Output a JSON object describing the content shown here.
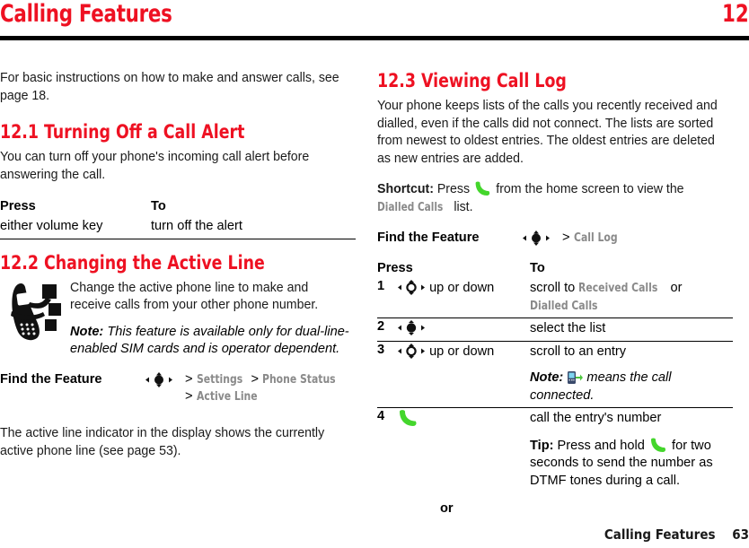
{
  "header": {
    "title": "Calling Features",
    "chapter_number": "12"
  },
  "footer": {
    "title": "Calling Features",
    "page_number": "63"
  },
  "left_column": {
    "intro": "For basic instructions on how to make and answer calls, see page 18.",
    "section_12_1": {
      "heading": "12.1 Turning Off a Call Alert",
      "body": "You can turn off your phone's incoming call alert before answering the call.",
      "table": {
        "col_press": "Press",
        "col_to": "To",
        "rows": [
          {
            "press": "either volume key",
            "to": "turn off the alert"
          }
        ]
      }
    },
    "section_12_2": {
      "heading": "12.2 Changing the Active Line",
      "illustration_icon": "phone-signal-icon",
      "body": "Change the active phone line to make and receive calls from your other phone number.",
      "note_label": "Note:",
      "note_text": "This feature is available only for dual-line-enabled SIM cards and is operator dependent.",
      "find_the_feature": {
        "label": "Find the Feature",
        "key_icon": "nav-key-select-icon",
        "path_line_1_sep": ">",
        "path_line_1_a": "Settings",
        "path_line_1_sep2": ">",
        "path_line_1_b": "Phone Status",
        "path_line_2_sep": ">",
        "path_line_2_a": "Active Line"
      },
      "closing": "The active line indicator in the display shows the currently active phone line (see page 53)."
    }
  },
  "right_column": {
    "section_12_3": {
      "heading": "12.3 Viewing Call Log",
      "body": "Your phone keeps lists of the calls you recently received and dialled, even if the calls did not connect. The lists are sorted from newest to oldest entries. The oldest entries are deleted as new entries are added.",
      "shortcut_label": "Shortcut:",
      "shortcut_text_1": "Press",
      "shortcut_icon": "send-key-icon",
      "shortcut_text_2": "from the home screen to view the",
      "shortcut_menu": "Dialled Calls",
      "shortcut_text_3": "list.",
      "find_the_feature": {
        "label": "Find the Feature",
        "key_icon": "nav-key-select-icon",
        "path_sep": ">",
        "path_item": "Call Log"
      },
      "table": {
        "col_press": "Press",
        "col_to": "To",
        "rows": [
          {
            "num": "1",
            "key_icon": "nav-key-scroll-icon",
            "key_text": "up or down",
            "to_text_1": "scroll to",
            "to_menu_1": "Received Calls",
            "to_text_2": "or",
            "to_menu_2": "Dialled Calls"
          },
          {
            "num": "2",
            "key_icon": "nav-key-select-icon",
            "key_text": "",
            "to_text_1": "select the list"
          },
          {
            "num": "3",
            "key_icon": "nav-key-scroll-icon",
            "key_text": "up or down",
            "to_text_1": "scroll to an entry",
            "note_label": "Note:",
            "note_icon": "phone-connected-icon",
            "note_text": "means the call connected."
          },
          {
            "num": "4",
            "key_icon": "send-key-icon",
            "key_text": "",
            "to_text_1": "call the entry's number",
            "tip_label": "Tip:",
            "tip_text_1": "Press and hold",
            "tip_icon": "send-key-icon",
            "tip_text_2": "for two seconds to send the number as DTMF tones during a call."
          }
        ],
        "or_label": "or"
      }
    }
  },
  "colors": {
    "accent_red": "#ee1122",
    "menu_gray": "#8a8a8a",
    "send_green": "#44d62c",
    "text_black": "#1a1a1a"
  }
}
